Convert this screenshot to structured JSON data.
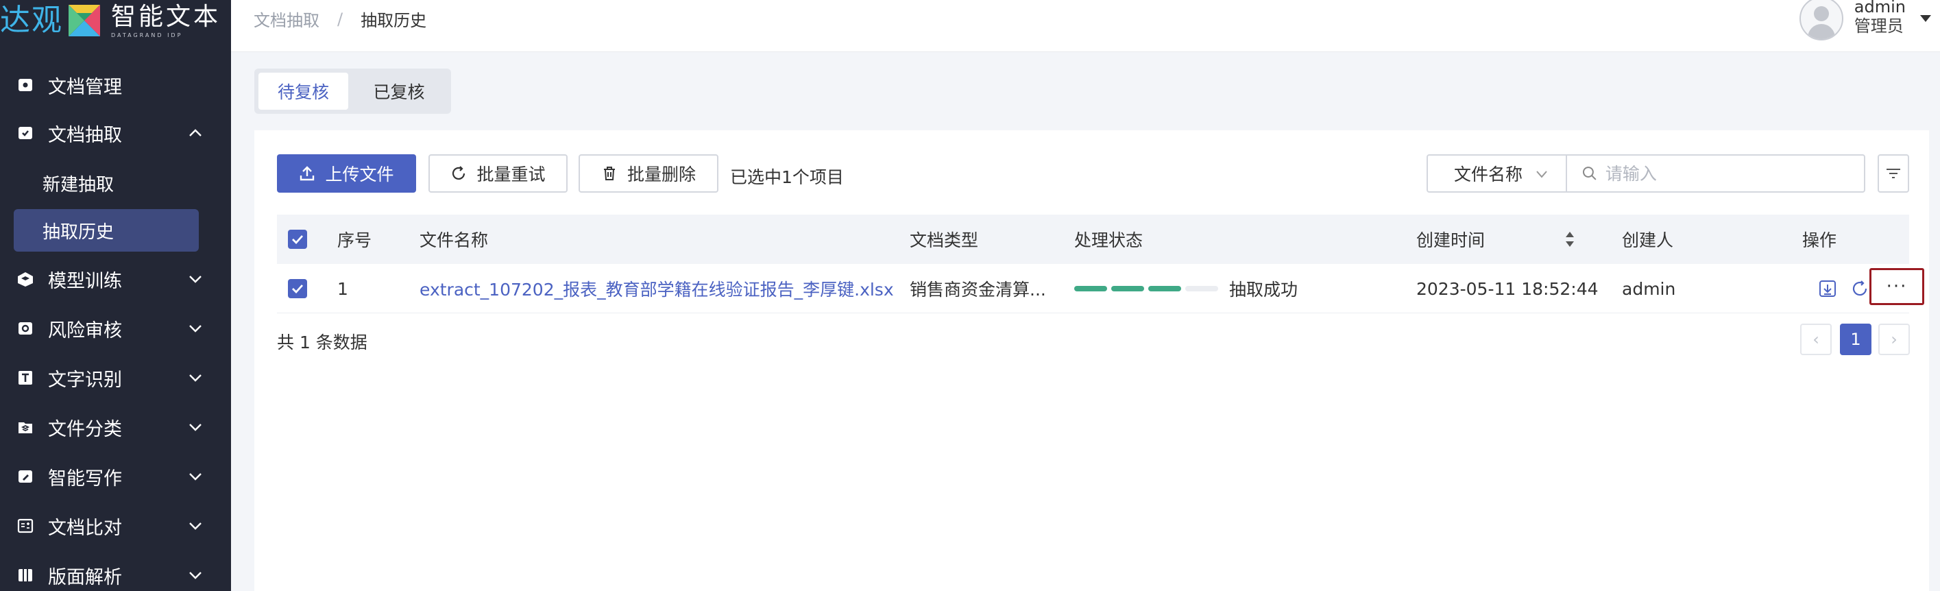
{
  "app": {
    "logo_brand": "达观",
    "logo_name": "智能文本",
    "logo_sub": "DATAGRAND IDP"
  },
  "sidebar": {
    "items": [
      {
        "label": "文档管理",
        "icon": "document-icon"
      },
      {
        "label": "文档抽取",
        "icon": "extract-icon",
        "expanded": true
      },
      {
        "label": "模型训练",
        "icon": "model-icon"
      },
      {
        "label": "风险审核",
        "icon": "risk-icon"
      },
      {
        "label": "文字识别",
        "icon": "text-ocr-icon"
      },
      {
        "label": "文件分类",
        "icon": "layers-icon"
      },
      {
        "label": "智能写作",
        "icon": "write-icon"
      },
      {
        "label": "文档比对",
        "icon": "compare-icon"
      },
      {
        "label": "版面解析",
        "icon": "layout-icon"
      }
    ],
    "sub_items": [
      {
        "label": "新建抽取"
      },
      {
        "label": "抽取历史",
        "active": true
      }
    ]
  },
  "header": {
    "breadcrumb": [
      "文档抽取",
      "抽取历史"
    ],
    "breadcrumb_sep": "/",
    "user_name": "admin",
    "user_role": "管理员"
  },
  "tabs": [
    {
      "label": "待复核",
      "active": true
    },
    {
      "label": "已复核",
      "active": false
    }
  ],
  "toolbar": {
    "upload": "上传文件",
    "retry": "批量重试",
    "delete": "批量删除",
    "selected_info": "已选中1个项目",
    "filter_field": "文件名称",
    "search_placeholder": "请输入"
  },
  "table": {
    "columns": [
      "序号",
      "文件名称",
      "文档类型",
      "处理状态",
      "创建时间",
      "创建人",
      "操作"
    ],
    "rows": [
      {
        "index": "1",
        "file_name": "extract_107202_报表_教育部学籍在线验证报告_李厚键.xlsx",
        "doc_type": "销售商资金清算...",
        "status": "抽取成功",
        "progress_segments_done": 3,
        "progress_segments_total": 4,
        "created_at": "2023-05-11 18:52:44",
        "creator": "admin",
        "more": "···"
      }
    ]
  },
  "pagination": {
    "total_text": "共 1 条数据",
    "current_page": "1",
    "prev": "‹",
    "next": "›"
  },
  "colors": {
    "sidebar_bg": "#232735",
    "primary": "#4b62c2",
    "progress": "#3fa986",
    "highlight_border": "#9b1b22"
  }
}
